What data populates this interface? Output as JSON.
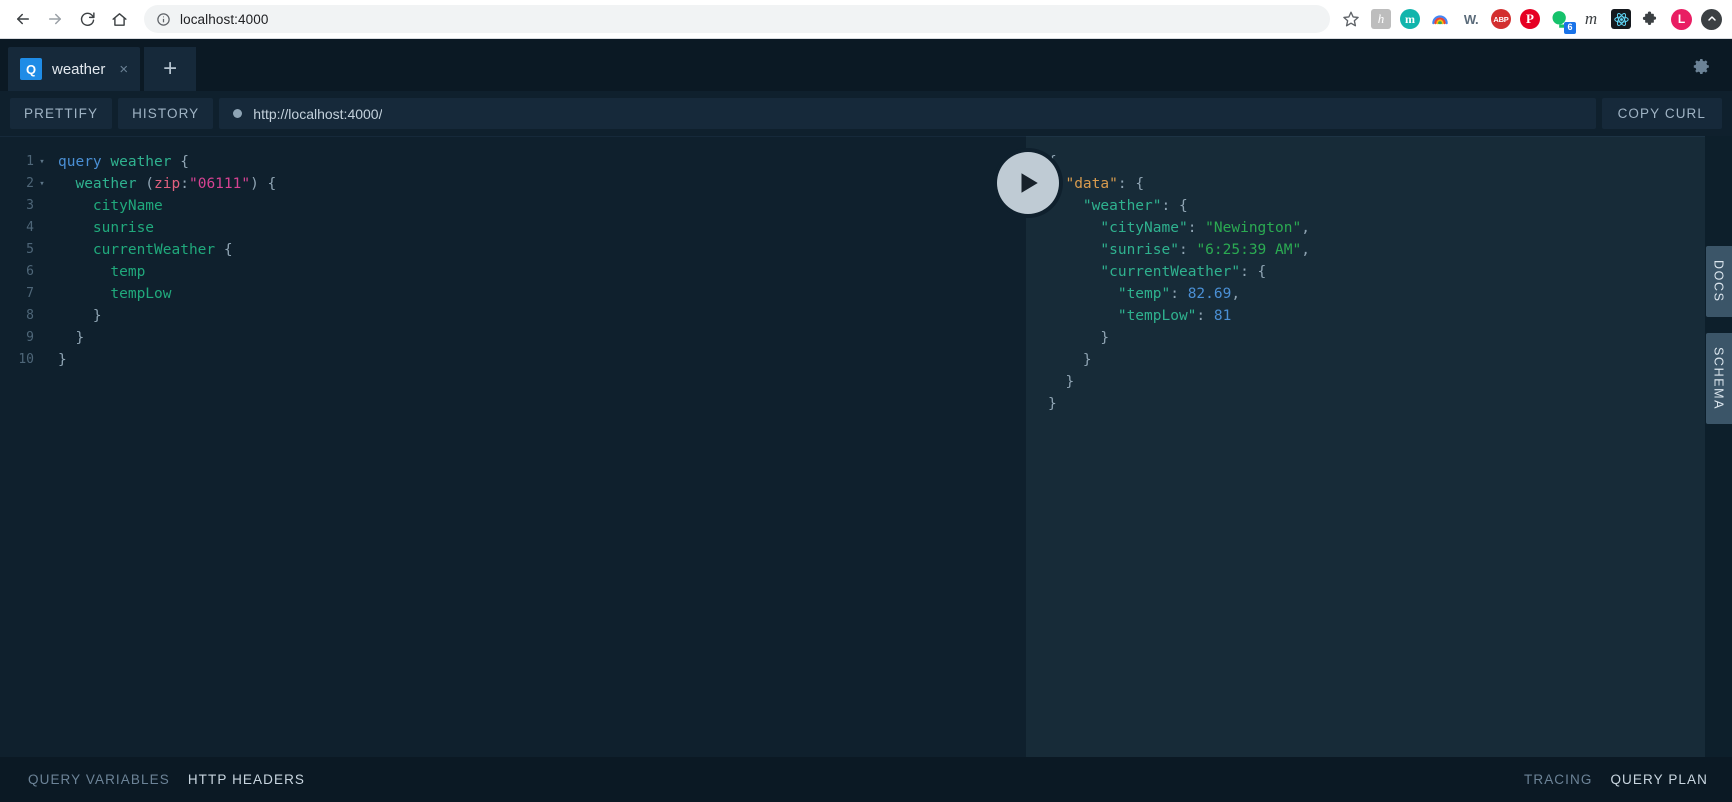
{
  "browser": {
    "back_icon": "back-arrow-icon",
    "forward_icon": "forward-arrow-icon",
    "reload_icon": "reload-icon",
    "home_icon": "home-icon",
    "site_info_icon": "site-info-icon",
    "url": "localhost:4000",
    "bookmark_icon": "star-icon",
    "extensions": [
      {
        "name": "honey-extension-icon",
        "label": "h"
      },
      {
        "name": "momentum-extension-icon",
        "label": "m"
      },
      {
        "name": "rainbow-extension-icon",
        "label": ""
      },
      {
        "name": "wikibuy-extension-icon",
        "label": "W."
      },
      {
        "name": "adblock-plus-extension-icon",
        "label": "ABP"
      },
      {
        "name": "pinterest-extension-icon",
        "label": "P"
      },
      {
        "name": "grammarly-extension-icon",
        "label": "",
        "badge": "6"
      },
      {
        "name": "medium-extension-icon",
        "label": "m"
      },
      {
        "name": "react-devtools-extension-icon",
        "label": ""
      },
      {
        "name": "extensions-puzzle-icon",
        "label": ""
      }
    ],
    "profile_avatar": "L",
    "menu_icon": "update-arrow-icon"
  },
  "playground": {
    "tab": {
      "badge": "Q",
      "title": "weather",
      "close_label": "×"
    },
    "new_tab_label": "+",
    "settings_icon": "gear-icon",
    "toolbar": {
      "prettify_label": "PRETTIFY",
      "history_label": "HISTORY",
      "endpoint_url": "http://localhost:4000/",
      "copy_curl_label": "COPY CURL"
    },
    "execute_icon": "play-icon",
    "side_tabs": [
      {
        "label": "DOCS",
        "name": "docs-tab"
      },
      {
        "label": "SCHEMA",
        "name": "schema-tab"
      }
    ],
    "bottom": {
      "query_variables_label": "QUERY VARIABLES",
      "http_headers_label": "HTTP HEADERS",
      "tracing_label": "TRACING",
      "query_plan_label": "QUERY PLAN"
    },
    "editor": {
      "lines": [
        {
          "n": "1",
          "fold": "▾",
          "indent": 0,
          "tokens": [
            {
              "c": "t-kw",
              "t": "query "
            },
            {
              "c": "t-name",
              "t": "weather"
            },
            {
              "c": "t-punc",
              "t": " {"
            }
          ]
        },
        {
          "n": "2",
          "fold": "▾",
          "indent": 1,
          "tokens": [
            {
              "c": "t-name",
              "t": "weather"
            },
            {
              "c": "t-punc",
              "t": " ("
            },
            {
              "c": "t-arg",
              "t": "zip"
            },
            {
              "c": "t-punc",
              "t": ":"
            },
            {
              "c": "t-str",
              "t": "\"06111\""
            },
            {
              "c": "t-punc",
              "t": ") {"
            }
          ]
        },
        {
          "n": "3",
          "fold": "",
          "indent": 2,
          "tokens": [
            {
              "c": "t-field",
              "t": "cityName"
            }
          ]
        },
        {
          "n": "4",
          "fold": "",
          "indent": 2,
          "tokens": [
            {
              "c": "t-field",
              "t": "sunrise"
            }
          ]
        },
        {
          "n": "5",
          "fold": "",
          "indent": 2,
          "tokens": [
            {
              "c": "t-field",
              "t": "currentWeather"
            },
            {
              "c": "t-punc",
              "t": " {"
            }
          ]
        },
        {
          "n": "6",
          "fold": "",
          "indent": 3,
          "tokens": [
            {
              "c": "t-field",
              "t": "temp"
            }
          ]
        },
        {
          "n": "7",
          "fold": "",
          "indent": 3,
          "tokens": [
            {
              "c": "t-field",
              "t": "tempLow"
            }
          ]
        },
        {
          "n": "8",
          "fold": "",
          "indent": 2,
          "tokens": [
            {
              "c": "t-punc",
              "t": "}"
            }
          ]
        },
        {
          "n": "9",
          "fold": "",
          "indent": 1,
          "tokens": [
            {
              "c": "t-punc",
              "t": "}"
            }
          ]
        },
        {
          "n": "10",
          "fold": "",
          "indent": 0,
          "tokens": [
            {
              "c": "t-punc",
              "t": "}"
            }
          ]
        }
      ]
    },
    "response": {
      "lines": [
        {
          "fold": "▾",
          "indent": 0,
          "tokens": [
            {
              "c": "r-punc",
              "t": "{"
            }
          ]
        },
        {
          "fold": "▾",
          "indent": 1,
          "tokens": [
            {
              "c": "r-data",
              "t": "\"data\""
            },
            {
              "c": "r-punc",
              "t": ": {"
            }
          ]
        },
        {
          "fold": "▾",
          "indent": 2,
          "tokens": [
            {
              "c": "r-key",
              "t": "\"weather\""
            },
            {
              "c": "r-punc",
              "t": ": {"
            }
          ]
        },
        {
          "fold": "",
          "indent": 3,
          "tokens": [
            {
              "c": "r-key",
              "t": "\"cityName\""
            },
            {
              "c": "r-punc",
              "t": ": "
            },
            {
              "c": "r-str",
              "t": "\"Newington\""
            },
            {
              "c": "r-punc",
              "t": ","
            }
          ]
        },
        {
          "fold": "",
          "indent": 3,
          "tokens": [
            {
              "c": "r-key",
              "t": "\"sunrise\""
            },
            {
              "c": "r-punc",
              "t": ": "
            },
            {
              "c": "r-str",
              "t": "\"6:25:39 AM\""
            },
            {
              "c": "r-punc",
              "t": ","
            }
          ]
        },
        {
          "fold": "",
          "indent": 3,
          "tokens": [
            {
              "c": "r-key",
              "t": "\"currentWeather\""
            },
            {
              "c": "r-punc",
              "t": ": {"
            }
          ]
        },
        {
          "fold": "",
          "indent": 4,
          "tokens": [
            {
              "c": "r-key",
              "t": "\"temp\""
            },
            {
              "c": "r-punc",
              "t": ": "
            },
            {
              "c": "r-num",
              "t": "82.69"
            },
            {
              "c": "r-punc",
              "t": ","
            }
          ]
        },
        {
          "fold": "",
          "indent": 4,
          "tokens": [
            {
              "c": "r-key",
              "t": "\"tempLow\""
            },
            {
              "c": "r-punc",
              "t": ": "
            },
            {
              "c": "r-num",
              "t": "81"
            }
          ]
        },
        {
          "fold": "",
          "indent": 3,
          "tokens": [
            {
              "c": "r-punc",
              "t": "}"
            }
          ]
        },
        {
          "fold": "",
          "indent": 2,
          "tokens": [
            {
              "c": "r-punc",
              "t": "}"
            }
          ]
        },
        {
          "fold": "",
          "indent": 1,
          "tokens": [
            {
              "c": "r-punc",
              "t": "}"
            }
          ]
        },
        {
          "fold": "",
          "indent": 0,
          "tokens": [
            {
              "c": "r-punc",
              "t": "}"
            }
          ]
        }
      ]
    }
  }
}
